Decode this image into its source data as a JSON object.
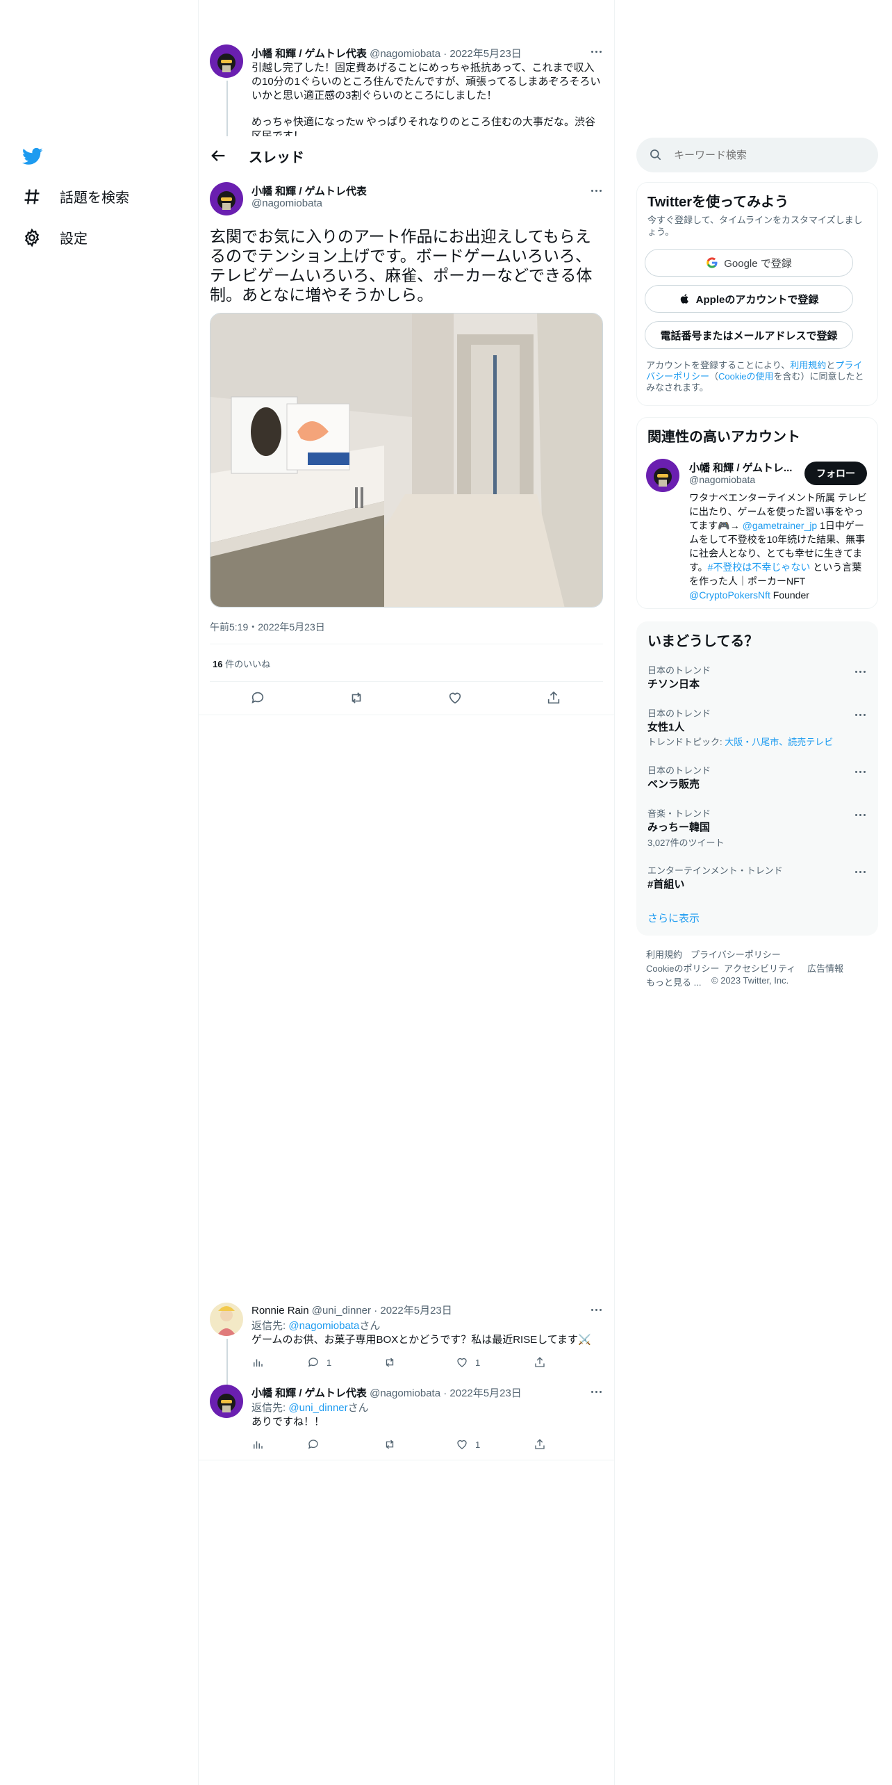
{
  "nav": {
    "explore_label": "話題を検索",
    "settings_label": "設定"
  },
  "header": {
    "title": "スレッド"
  },
  "prev_tweet": {
    "author": "小幡 和輝 / ゲムトレ代表",
    "handle": "@nagomiobata",
    "date": "2022年5月23日",
    "text_1": "引越し完了した！固定費あげることにめっちゃ抵抗あって、これまで収入の10分の1ぐらいのところ住んでたんですが、頑張ってるしまあぞろそろいいかと思い適正感の3割ぐらいのところにしました！",
    "text_2": "めっちゃ快適になったw やっぱりそれなりのところ住むの大事だな。渋谷区民です！"
  },
  "main_tweet": {
    "author": "小幡 和輝 / ゲムトレ代表",
    "handle": "@nagomiobata",
    "text": "玄関でお気に入りのアート作品にお出迎えしてもらえるのでテンション上げです。ボードゲームいろいろ、テレビゲームいろいろ、麻雀、ポーカーなどできる体制。あとなに増やそうかしら。",
    "timestamp": "午前5:19・2022年5月23日",
    "likes_count": "16",
    "likes_label": "件のいいね"
  },
  "replies": [
    {
      "author": "Ronnie Rain",
      "handle": "@uni_dinner",
      "date": "2022年5月23日",
      "reply_prefix": "返信先: ",
      "reply_to": "@nagomiobata",
      "reply_suffix": "さん",
      "text": "ゲームのお供、お菓子専用BOXとかどうです？私は最近RISEしてます⚔️",
      "reply_count": "1",
      "like_count": "1"
    },
    {
      "author": "小幡 和輝 / ゲムトレ代表",
      "handle": "@nagomiobata",
      "date": "2022年5月23日",
      "reply_prefix": "返信先: ",
      "reply_to": "@uni_dinner",
      "reply_suffix": "さん",
      "text": "ありですね！！",
      "like_count": "1"
    }
  ],
  "search": {
    "placeholder": "キーワード検索"
  },
  "signup": {
    "title": "Twitterを使ってみよう",
    "subtitle": "今すぐ登録して、タイムラインをカスタマイズしましょう。",
    "google_label": "Google で登録",
    "apple_label": "Appleのアカウントで登録",
    "phone_label": "電話番号またはメールアドレスで登録",
    "terms_1": "アカウントを登録することにより、",
    "terms_link_1": "利用規約",
    "terms_2": "と",
    "terms_link_2": "プライバシーポリシー",
    "terms_3": "（",
    "terms_link_3": "Cookieの使用",
    "terms_4": "を含む）に同意したとみなされます。"
  },
  "related": {
    "title": "関連性の高いアカウント",
    "name": "小幡 和輝 / ゲムトレ...",
    "handle": "@nagomiobata",
    "follow_label": "フォロー",
    "bio_1": "ワタナベエンターテイメント所属 テレビに出たり、ゲームを使った習い事をやってます🎮→ ",
    "bio_link_1": "@gametrainer_jp",
    "bio_2": " 1日中ゲームをして不登校を10年続けた結果、無事に社会人となり、とても幸せに生きてます。",
    "bio_link_2": "#不登校は不幸じゃない",
    "bio_3": " という言葉を作った人｜ポーカーNFT ",
    "bio_link_3": "@CryptoPokersNft",
    "bio_4": " Founder"
  },
  "trends": {
    "title": "いまどうしてる？",
    "items": [
      {
        "meta": "日本のトレンド",
        "name": "チソン日本"
      },
      {
        "meta": "日本のトレンド",
        "name": "女性1人",
        "topic_label": "トレンドトピック: ",
        "topic": "大阪・八尾市、読売テレビ"
      },
      {
        "meta": "日本のトレンド",
        "name": "ベンラ販売"
      },
      {
        "meta": "音楽・トレンド",
        "name": "みっちー韓国",
        "count": "3,027件のツイート"
      },
      {
        "meta": "エンターテインメント・トレンド",
        "name": "#首組い"
      }
    ],
    "show_more": "さらに表示"
  },
  "footer": {
    "terms": "利用規約",
    "privacy": "プライバシーポリシー",
    "cookie": "Cookieのポリシー",
    "accessibility": "アクセシビリティ",
    "ads": "広告情報",
    "more": "もっと見る ...",
    "copyright": "© 2023 Twitter, Inc."
  },
  "colors": {
    "accent": "#1d9bf0",
    "text": "#0f1419",
    "muted": "#536471"
  }
}
